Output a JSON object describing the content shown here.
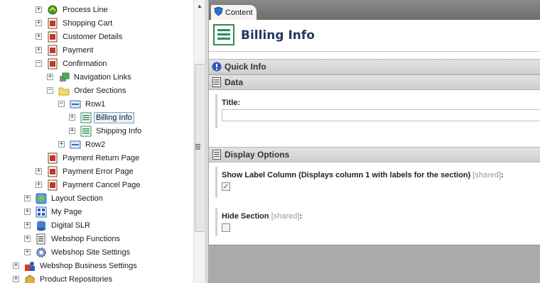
{
  "tree": {
    "items": [
      {
        "label": "Process Line",
        "expander": "+",
        "icon": "process-line-icon"
      },
      {
        "label": "Shopping Cart",
        "expander": "+",
        "icon": "page-icon"
      },
      {
        "label": "Customer Details",
        "expander": "+",
        "icon": "page-icon"
      },
      {
        "label": "Payment",
        "expander": "+",
        "icon": "page-icon"
      },
      {
        "label": "Confirmation",
        "expander": "−",
        "icon": "page-icon"
      },
      {
        "label": "Navigation Links",
        "expander": "+",
        "icon": "navigation-links-icon"
      },
      {
        "label": "Order Sections",
        "expander": "−",
        "icon": "folder-icon"
      },
      {
        "label": "Row1",
        "expander": "−",
        "icon": "row-icon"
      },
      {
        "label": "Billing Info",
        "expander": "+",
        "icon": "section-icon",
        "selected": true
      },
      {
        "label": "Shipping Info",
        "expander": "+",
        "icon": "section-icon"
      },
      {
        "label": "Row2",
        "expander": "+",
        "icon": "row-icon"
      },
      {
        "label": "Payment Return Page",
        "expander": "",
        "icon": "page-icon"
      },
      {
        "label": "Payment Error Page",
        "expander": "+",
        "icon": "page-icon"
      },
      {
        "label": "Payment Cancel Page",
        "expander": "+",
        "icon": "page-icon"
      },
      {
        "label": "Layout Section",
        "expander": "+",
        "icon": "layout-section-icon"
      },
      {
        "label": "My Page",
        "expander": "+",
        "icon": "grid-page-icon"
      },
      {
        "label": "Digital SLR",
        "expander": "+",
        "icon": "database-icon"
      },
      {
        "label": "Webshop Functions",
        "expander": "+",
        "icon": "functions-icon"
      },
      {
        "label": "Webshop Site Settings",
        "expander": "+",
        "icon": "settings-gear-icon"
      },
      {
        "label": "Webshop Business Settings",
        "expander": "+",
        "icon": "business-settings-icon"
      },
      {
        "label": "Product Repositories",
        "expander": "+",
        "icon": "repository-icon"
      }
    ]
  },
  "tab": {
    "label": "Content"
  },
  "header": {
    "title": "Billing Info"
  },
  "sections": {
    "quick_info": "Quick Info",
    "data": "Data",
    "display_options": "Display Options"
  },
  "fields": {
    "title_label": "Title:",
    "title_value": "",
    "show_label_column": "Show Label Column (Displays column 1 with labels for the section)",
    "show_label_column_checked": true,
    "hide_section": "Hide Section",
    "hide_section_checked": false,
    "shared_tag": "[shared]",
    "colon": ":"
  },
  "colors": {
    "accent": "#2a5db0",
    "title": "#1f3a5f",
    "selection": "#e8f1fb"
  }
}
